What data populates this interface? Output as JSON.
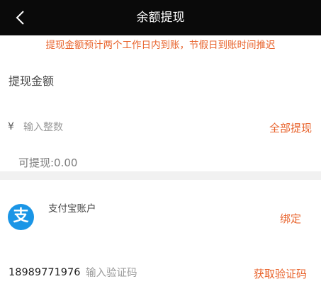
{
  "header": {
    "title": "余额提现",
    "back_icon": "chevron-left-icon"
  },
  "notice": "提现金额预计两个工作日内到账，节假日到账时间推迟",
  "amount_section": {
    "label": "提现金额",
    "currency_symbol": "¥",
    "input_placeholder": "输入整数",
    "input_value": "",
    "withdraw_all_label": "全部提现",
    "available_text": "可提现:0.00"
  },
  "account_section": {
    "logo_icon": "alipay-icon",
    "logo_glyph": "支",
    "account_label": "支付宝账户",
    "bind_label": "绑定"
  },
  "verify_section": {
    "phone": "18989771976",
    "code_placeholder": "输入验证码",
    "get_code_label": "获取验证码"
  },
  "colors": {
    "header_bg": "#0a0a0a",
    "accent": "#e8632c",
    "alipay_blue": "#1a95e6",
    "divider_bg": "#f1f1f1"
  }
}
